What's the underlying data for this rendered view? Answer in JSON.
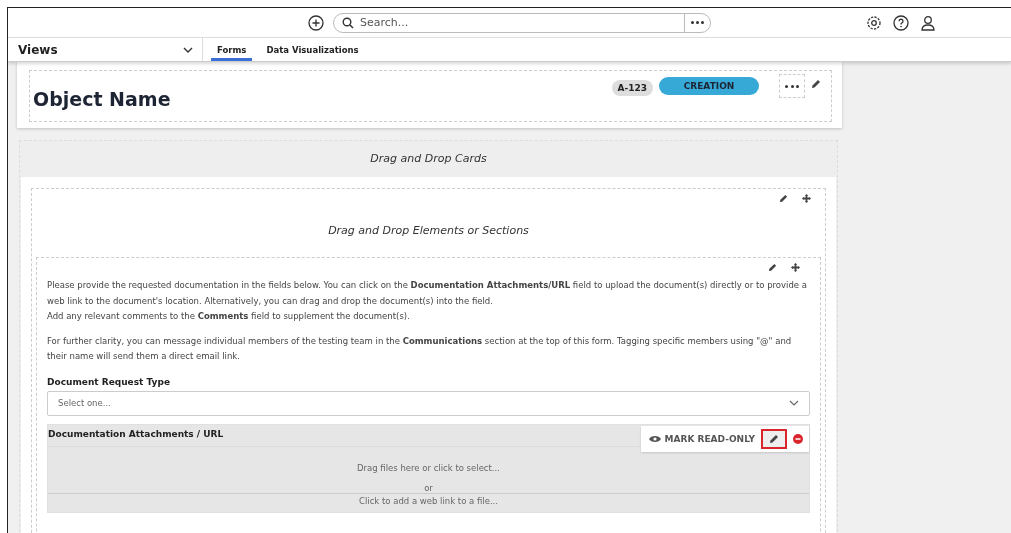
{
  "top_bar": {
    "search": {
      "placeholder": "Search..."
    }
  },
  "views_bar": {
    "title": "Views",
    "tabs": [
      {
        "label": "Forms",
        "selected": true
      },
      {
        "label": "Data Visualizations",
        "selected": false
      }
    ]
  },
  "object": {
    "name": "Object Name",
    "id_badge": "A-123",
    "status": "CREATION"
  },
  "cards_area": {
    "title": "Drag and Drop Cards"
  },
  "card": {
    "title": "Drag and Drop Elements or Sections",
    "paragraphs": [
      "Please provide the requested documentation in the fields below. You can click on the **Documentation Attachments/URL** field to upload the document(s) directly or to provide a web link to the document's location. Alternatively, you can drag and drop the document(s) into the field.\nAdd any relevant comments to the **Comments** field to supplement the document(s).",
      "For further clarity, you can message individual members of the testing team in the **Communications** section at the top of this form. Tagging specific members using \"@\" and their name will send them a direct email link."
    ],
    "select_field": {
      "label": "Document Request Type",
      "placeholder": "Select one..."
    },
    "attachments": {
      "label": "Documentation Attachments / URL",
      "mark_read_only": "MARK READ-ONLY",
      "drop_text": "Drag files here or click to select...",
      "or": "or",
      "link_text": "Click to add a web link to a file..."
    }
  }
}
